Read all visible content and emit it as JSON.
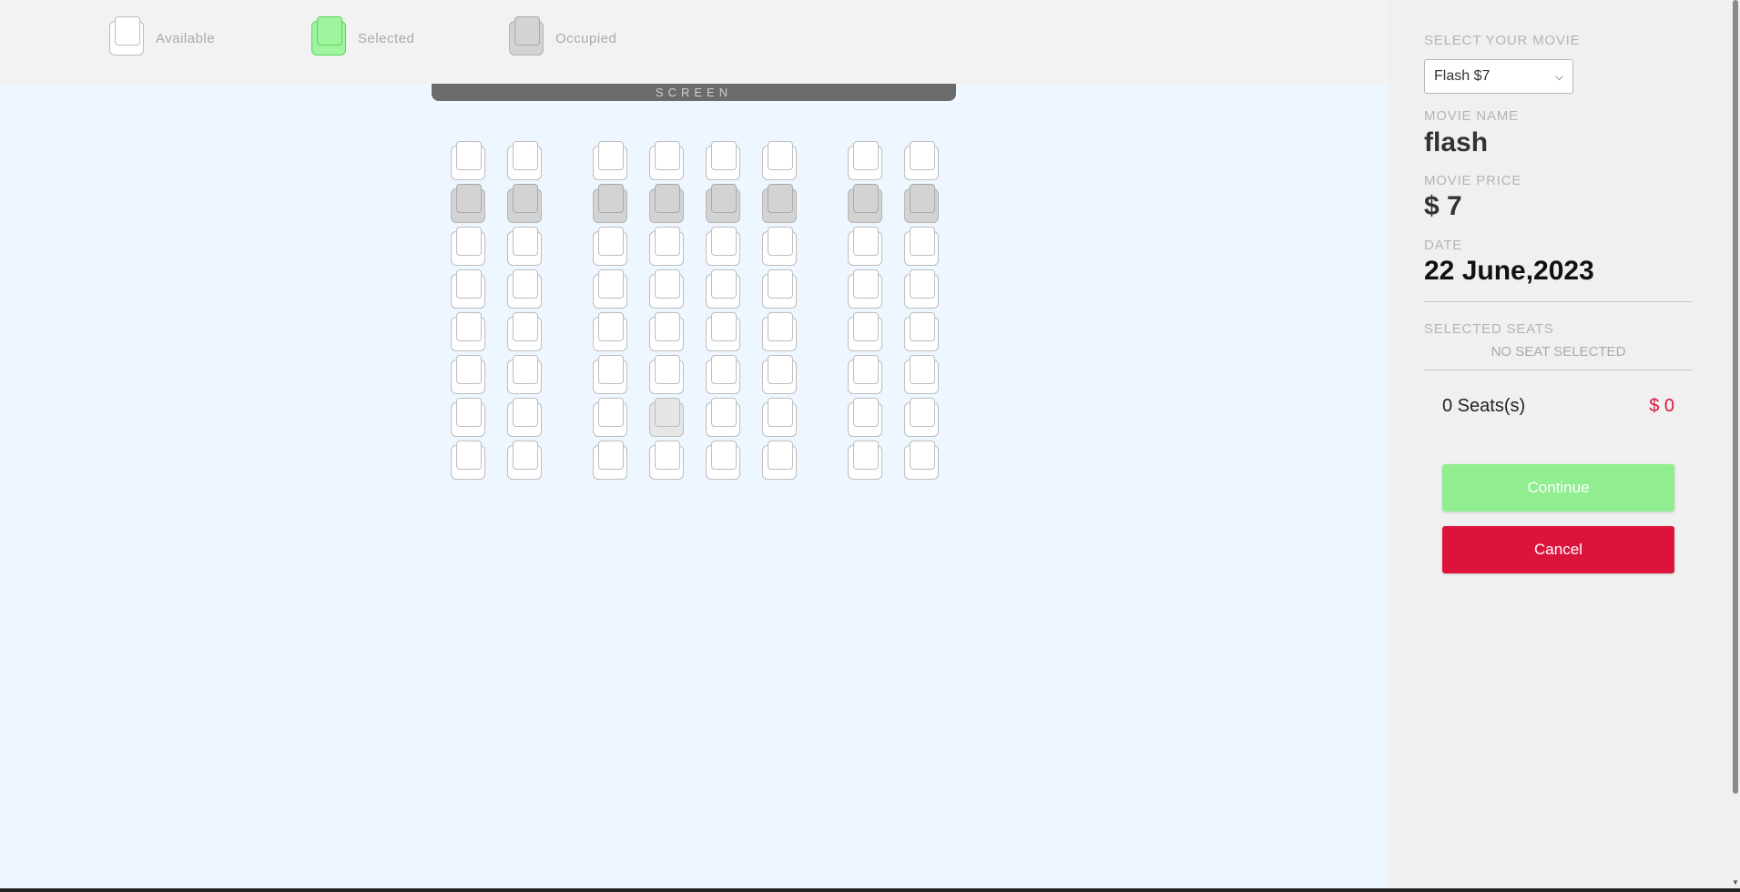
{
  "legend": {
    "available": "Available",
    "selected": "Selected",
    "occupied": "Occupied"
  },
  "screen_label": "SCREEN",
  "seat_rows": [
    [
      "available",
      "available",
      "available",
      "available",
      "available",
      "available",
      "available",
      "available"
    ],
    [
      "occupied",
      "occupied",
      "occupied",
      "occupied",
      "occupied",
      "occupied",
      "occupied",
      "occupied"
    ],
    [
      "available",
      "available",
      "available",
      "available",
      "available",
      "available",
      "available",
      "available"
    ],
    [
      "available",
      "available",
      "available",
      "available",
      "available",
      "available",
      "available",
      "available"
    ],
    [
      "available",
      "available",
      "available",
      "available",
      "available",
      "available",
      "available",
      "available"
    ],
    [
      "available",
      "available",
      "available",
      "available",
      "available",
      "available",
      "available",
      "available"
    ],
    [
      "available",
      "available",
      "available",
      "hover",
      "available",
      "available",
      "available",
      "available"
    ],
    [
      "available",
      "available",
      "available",
      "available",
      "available",
      "available",
      "available",
      "available"
    ]
  ],
  "panel": {
    "select_label": "SELECT YOUR MOVIE",
    "movie_option": "Flash $7",
    "name_label": "MOVIE NAME",
    "name_value": "flash",
    "price_label": "MOVIE PRICE",
    "price_value": "$ 7",
    "date_label": "DATE",
    "date_value": "22 June,2023",
    "selected_seats_label": "SELECTED SEATS",
    "no_seat_text": "NO SEAT SELECTED",
    "seat_count": "0 Seats(s)",
    "total": "$ 0",
    "continue_label": "Continue",
    "cancel_label": "Cancel"
  },
  "colors": {
    "selected": "#9ef59e",
    "occupied": "#d3d3d3",
    "continue": "#90ee90",
    "cancel": "#dc143c",
    "seat_area_bg": "#eef7ff"
  }
}
